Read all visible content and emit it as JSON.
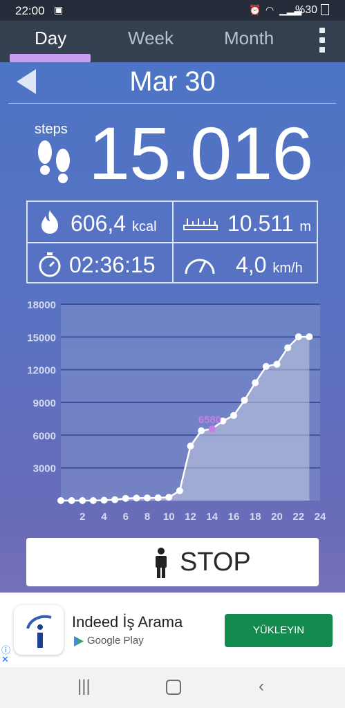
{
  "status_bar": {
    "time": "22:00",
    "battery": "%30",
    "icons": [
      "alarm-icon",
      "wifi-icon",
      "signal-icon",
      "battery-icon"
    ]
  },
  "tabs": [
    {
      "label": "Day",
      "active": true
    },
    {
      "label": "Week",
      "active": false
    },
    {
      "label": "Month",
      "active": false
    }
  ],
  "date_header": {
    "title": "Mar 30"
  },
  "steps": {
    "label": "steps",
    "value": "15.016"
  },
  "stats": {
    "calories": {
      "value": "606,4",
      "unit": "kcal"
    },
    "distance": {
      "value": "10.511",
      "unit": "m"
    },
    "duration": {
      "value": "02:36:15"
    },
    "speed": {
      "value": "4,0",
      "unit": "km/h"
    }
  },
  "chart_data": {
    "type": "area",
    "title": "",
    "xlabel": "",
    "ylabel": "",
    "x_ticks": [
      "2",
      "4",
      "6",
      "8",
      "10",
      "12",
      "14",
      "16",
      "18",
      "20",
      "22",
      "24"
    ],
    "y_ticks": [
      "3000",
      "6000",
      "9000",
      "12000",
      "15000",
      "18000"
    ],
    "xlim": [
      0,
      24
    ],
    "ylim": [
      0,
      18000
    ],
    "x": [
      0,
      1,
      2,
      3,
      4,
      5,
      6,
      7,
      8,
      9,
      10,
      11,
      12,
      13,
      14,
      15,
      16,
      17,
      18,
      19,
      20,
      21,
      22,
      23
    ],
    "values": [
      0,
      0,
      0,
      0,
      30,
      80,
      200,
      230,
      240,
      250,
      300,
      900,
      5000,
      6400,
      6580,
      7300,
      7800,
      9200,
      10800,
      12300,
      12500,
      14000,
      15016,
      15016
    ],
    "highlight": {
      "x": 14,
      "value": 6580,
      "label": "6580"
    },
    "colors": {
      "line": "#ffffff",
      "highlight": "#c77ee6",
      "fill": "#c5cce0"
    },
    "grid": true
  },
  "stop_button": {
    "label": "STOP"
  },
  "ad": {
    "title": "Indeed İş Arama",
    "store": "Google Play",
    "cta": "YÜKLEYIN"
  },
  "nav": {
    "recent": "recent-apps",
    "home": "home",
    "back": "back"
  }
}
